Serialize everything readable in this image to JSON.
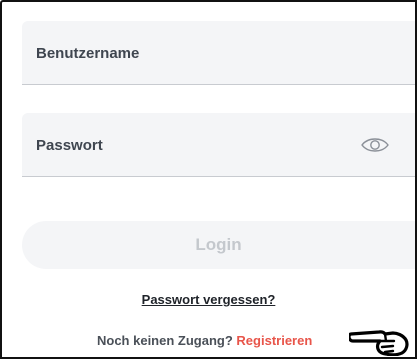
{
  "form": {
    "username_placeholder": "Benutzername",
    "password_placeholder": "Passwort",
    "password_toggle_icon": "eye-icon",
    "login_label": "Login",
    "forgot_label": "Passwort vergessen?",
    "no_account_text": "Noch keinen Zugang?",
    "register_label": "Registrieren",
    "pointer_icon": "pointing-hand-icon"
  },
  "colors": {
    "link_accent": "#e8554a",
    "field_bg": "#f4f5f7",
    "button_text_disabled": "#c4c8cd"
  }
}
